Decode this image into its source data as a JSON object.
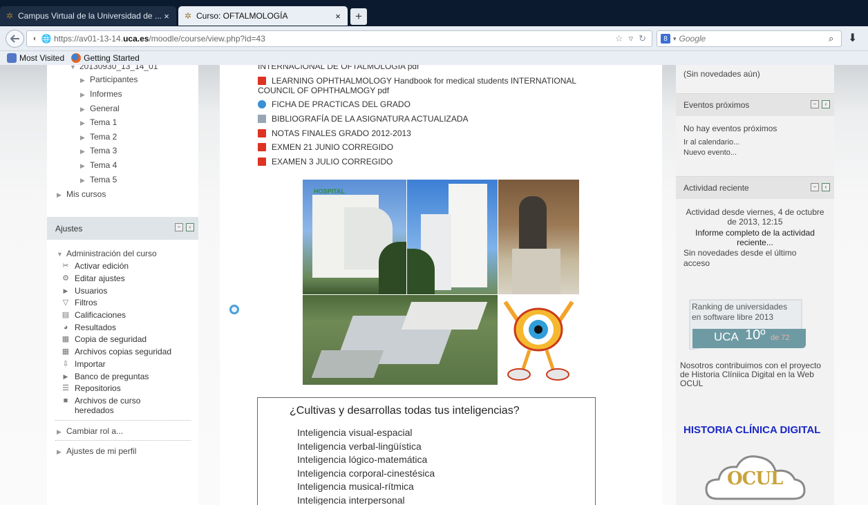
{
  "browser": {
    "tabs": [
      {
        "title": "Campus Virtual de la Universidad de ...",
        "close": "×"
      },
      {
        "title": "Curso: OFTALMOLOGÍA",
        "close": "×"
      }
    ],
    "new_tab": "+",
    "url_prefix": "https://av01-13-14.",
    "url_domain": "uca.es",
    "url_path": "/moodle/course/view.php?id=43",
    "search_engine_badge": "8",
    "search_placeholder": "Google",
    "bookmarks": [
      "Most Visited",
      "Getting Started"
    ]
  },
  "left_nav": {
    "cut_item": "20130930_13_14_01",
    "items": [
      "Participantes",
      "Informes",
      "General",
      "Tema 1",
      "Tema 2",
      "Tema 3",
      "Tema 4",
      "Tema 5"
    ],
    "mis_cursos": "Mis cursos",
    "settings_title": "Ajustes",
    "admin_title": "Administración del curso",
    "admin_items": [
      "Activar edición",
      "Editar ajustes",
      "Usuarios",
      "Filtros",
      "Calificaciones",
      "Resultados",
      "Copia de seguridad",
      "Archivos copias seguridad",
      "Importar",
      "Banco de preguntas",
      "Repositorios"
    ],
    "archivos_line1": "Archivos de curso",
    "archivos_line2": "heredados",
    "cambiar_rol": "Cambiar rol a...",
    "ajustes_perfil": "Ajustes de mi perfil"
  },
  "main": {
    "cut_resource": "INTERNACIONAL DE OFTALMOLOGIA pdf",
    "resources": [
      {
        "line1": "LEARNING OPHTHALMOLOGY Handbook for medical students INTERNATIONAL",
        "line2": "COUNCIL OF OPHTHALMOGY pdf",
        "icon": "pdf-icon"
      },
      {
        "line1": "FICHA DE PRACTICAS DEL GRADO",
        "icon": "web-icon"
      },
      {
        "line1": "BIBLIOGRAFÍA DE LA ASIGNATURA ACTUALIZADA",
        "icon": "doc-icon"
      },
      {
        "line1": "NOTAS FINALES GRADO 2012-2013",
        "icon": "pdf-icon"
      },
      {
        "line1": "EXMEN 21 JUNIO CORREGIDO",
        "icon": "pdf-icon"
      },
      {
        "line1": "EXAMEN 3 JULIO CORREGIDO",
        "icon": "pdf-icon"
      }
    ],
    "hospital_sign": "HOSPITAL",
    "intelligences_question": "¿Cultivas y desarrollas todas tus inteligencias?",
    "intelligences": [
      "Inteligencia visual-espacial",
      "Inteligencia verbal-lingüística",
      "Inteligencia lógico-matemática",
      "Inteligencia corporal-cinestésica",
      "Inteligencia musical-rítmica",
      "Inteligencia interpersonal"
    ]
  },
  "right": {
    "no_news": "(Sin novedades aún)",
    "events_title": "Eventos próximos",
    "no_events": "No hay eventos próximos",
    "go_calendar": "Ir al calendario...",
    "new_event": "Nuevo evento...",
    "activity_title": "Actividad reciente",
    "activity_since_1": "Actividad desde viernes, 4 de octubre",
    "activity_since_2": "de 2013, 12:15",
    "full_report_1": "Informe completo de la actividad",
    "full_report_2": "reciente...",
    "no_changes_1": "Sin novedades desde el último",
    "no_changes_2": "acceso",
    "ranking_line1": "Ranking de universidades",
    "ranking_line2": "en software libre 2013",
    "ranking_uca": "UCA",
    "ranking_pos": "10º",
    "ranking_of": "de 72",
    "contrib_1": "Nosotros contribuimos con el proyecto",
    "contrib_2": "de Historia Clíniica Digital en la Web",
    "contrib_3": "OCUL",
    "hcd_title": "HISTORIA CLÍNICA DIGITAL",
    "ocul_logo": "OCUL"
  },
  "colors": {
    "tabbar": "#0c1a2f",
    "pdf": "#dd3322",
    "hcd_title": "#1b27c6",
    "header_blue": "#dfe4e8"
  }
}
